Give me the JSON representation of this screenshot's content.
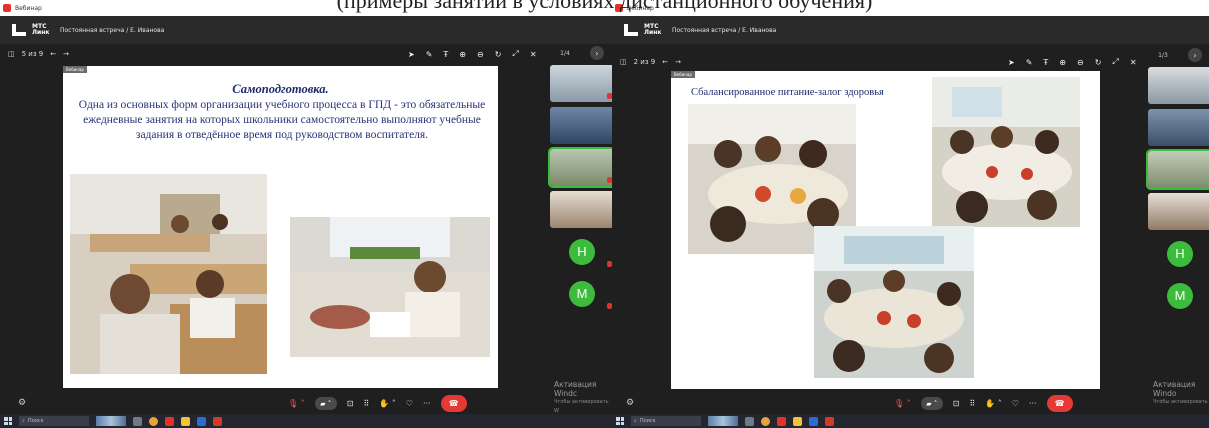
{
  "caption": "(примеры занятий в условиях дистанционного обучения)",
  "left": {
    "window_title": "Вебинар",
    "brand": "МТС Линк",
    "meeting_title": "Постоянная встреча / Е. Иванова",
    "page_counter": "5 из 9",
    "slide_badge": "Вебинар",
    "slide_title": "Самоподготовка.",
    "slide_text": "Одна из основных форм организации учебного процесса в ГПД - это обязательные ежедневные занятия на которых школьники самостоятельно выполняют учебные задания в отведённое время под руководством воспитателя.",
    "sidebar_page": "1/4",
    "avatars": [
      "Н",
      "М"
    ],
    "watermark_title": "Активация Windc",
    "watermark_sub": "Чтобы активировать W",
    "search_placeholder": "Поиск"
  },
  "right": {
    "window_title": "Вебинар",
    "brand": "МТС Линк",
    "meeting_title": "Постоянная встреча / Е. Иванова",
    "page_counter": "2 из 9",
    "slide_badge": "Вебинар",
    "slide_title": "Сбалансированное питание-залог здоровья",
    "sidebar_page": "1/3",
    "avatars": [
      "Н",
      "М"
    ],
    "watermark_title": "Активация Windo",
    "watermark_sub": "Чтобы активировать",
    "search_placeholder": "Поиск"
  },
  "colors": {
    "accent_green": "#3dbb3d",
    "hangup_red": "#e53935",
    "slide_text_blue": "#2a3278",
    "dark_bg": "#1f1f1f"
  },
  "icons": [
    "sidebar-toggle-icon",
    "arrow-left-icon",
    "arrow-right-icon",
    "cursor-icon",
    "pen-icon",
    "text-tool-icon",
    "zoom-in-icon",
    "zoom-out-icon",
    "reset-icon",
    "expand-icon",
    "close-icon",
    "mic-off-icon",
    "camera-icon",
    "screen-share-icon",
    "participants-icon",
    "hand-icon",
    "reactions-icon",
    "more-icon",
    "hangup-icon",
    "settings-icon"
  ]
}
